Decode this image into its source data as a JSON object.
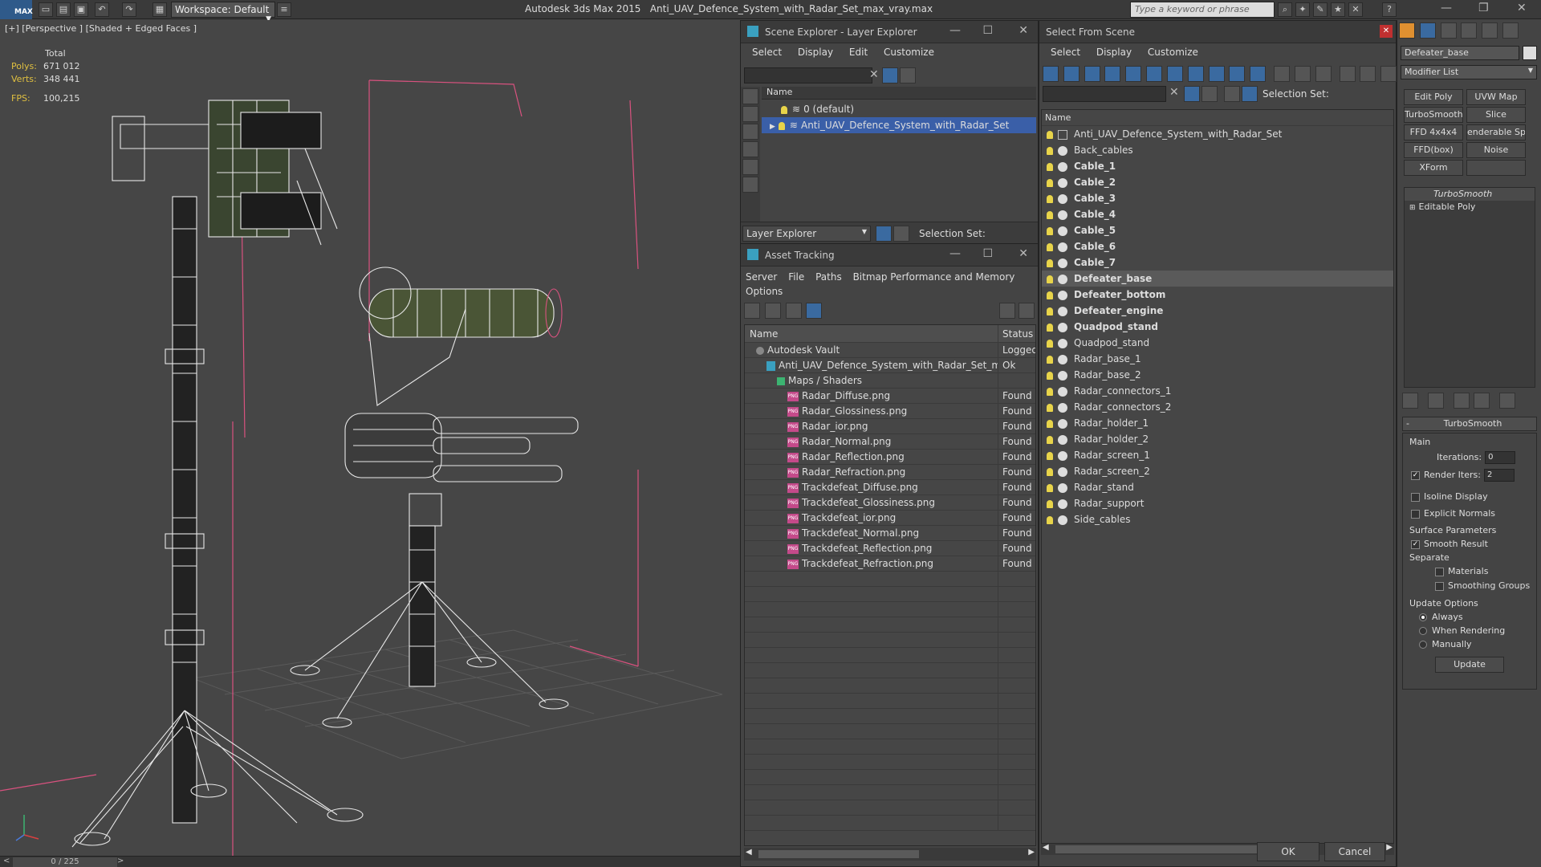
{
  "titlebar": {
    "logo": "MAX",
    "workspace": "Workspace: Default",
    "app_name": "Autodesk 3ds Max  2015",
    "file_name": "Anti_UAV_Defence_System_with_Radar_Set_max_vray.max",
    "search_placeholder": "Type a keyword or phrase"
  },
  "viewport": {
    "label": "[+] [Perspective ] [Shaded + Edged Faces ]",
    "stats_total": "Total",
    "polys_label": "Polys:",
    "polys_value": "671 012",
    "verts_label": "Verts:",
    "verts_value": "348 441",
    "fps_label": "FPS:",
    "fps_value": "100,215"
  },
  "timeline": {
    "frame": "0 / 225",
    "left": "<",
    "right": ">"
  },
  "scene_explorer": {
    "title": "Scene Explorer - Layer Explorer",
    "menu": [
      "Select",
      "Display",
      "Edit",
      "Customize"
    ],
    "col_name": "Name",
    "layers": [
      "0 (default)",
      "Anti_UAV_Defence_System_with_Radar_Set"
    ],
    "footer_label": "Layer Explorer",
    "selection_set": "Selection Set:"
  },
  "asset_tracking": {
    "title": "Asset Tracking",
    "menu": [
      "Server",
      "File",
      "Paths",
      "Bitmap Performance and Memory"
    ],
    "menu2": "Options",
    "col_name": "Name",
    "col_status": "Status",
    "rows": [
      {
        "name": "Autodesk Vault",
        "status": "Logged",
        "indent": 0
      },
      {
        "name": "Anti_UAV_Defence_System_with_Radar_Set_ma...",
        "status": "Ok",
        "indent": 1
      },
      {
        "name": "Maps / Shaders",
        "status": "",
        "indent": 2
      },
      {
        "name": "Radar_Diffuse.png",
        "status": "Found",
        "indent": 3
      },
      {
        "name": "Radar_Glossiness.png",
        "status": "Found",
        "indent": 3
      },
      {
        "name": "Radar_ior.png",
        "status": "Found",
        "indent": 3
      },
      {
        "name": "Radar_Normal.png",
        "status": "Found",
        "indent": 3
      },
      {
        "name": "Radar_Reflection.png",
        "status": "Found",
        "indent": 3
      },
      {
        "name": "Radar_Refraction.png",
        "status": "Found",
        "indent": 3
      },
      {
        "name": "Trackdefeat_Diffuse.png",
        "status": "Found",
        "indent": 3
      },
      {
        "name": "Trackdefeat_Glossiness.png",
        "status": "Found",
        "indent": 3
      },
      {
        "name": "Trackdefeat_ior.png",
        "status": "Found",
        "indent": 3
      },
      {
        "name": "Trackdefeat_Normal.png",
        "status": "Found",
        "indent": 3
      },
      {
        "name": "Trackdefeat_Reflection.png",
        "status": "Found",
        "indent": 3
      },
      {
        "name": "Trackdefeat_Refraction.png",
        "status": "Found",
        "indent": 3
      }
    ]
  },
  "select_from_scene": {
    "title": "Select From Scene",
    "menu": [
      "Select",
      "Display",
      "Customize"
    ],
    "selection_set": "Selection Set:",
    "col_name": "Name",
    "objects": [
      {
        "name": "Anti_UAV_Defence_System_with_Radar_Set",
        "bold": false
      },
      {
        "name": "Back_cables",
        "bold": false
      },
      {
        "name": "Cable_1",
        "bold": true
      },
      {
        "name": "Cable_2",
        "bold": true
      },
      {
        "name": "Cable_3",
        "bold": true
      },
      {
        "name": "Cable_4",
        "bold": true
      },
      {
        "name": "Cable_5",
        "bold": true
      },
      {
        "name": "Cable_6",
        "bold": true
      },
      {
        "name": "Cable_7",
        "bold": true
      },
      {
        "name": "Defeater_base",
        "bold": true
      },
      {
        "name": "Defeater_bottom",
        "bold": true
      },
      {
        "name": "Defeater_engine",
        "bold": true
      },
      {
        "name": "Quadpod_stand",
        "bold": true
      },
      {
        "name": "Quadpod_stand",
        "bold": false
      },
      {
        "name": "Radar_base_1",
        "bold": false
      },
      {
        "name": "Radar_base_2",
        "bold": false
      },
      {
        "name": "Radar_connectors_1",
        "bold": false
      },
      {
        "name": "Radar_connectors_2",
        "bold": false
      },
      {
        "name": "Radar_holder_1",
        "bold": false
      },
      {
        "name": "Radar_holder_2",
        "bold": false
      },
      {
        "name": "Radar_screen_1",
        "bold": false
      },
      {
        "name": "Radar_screen_2",
        "bold": false
      },
      {
        "name": "Radar_stand",
        "bold": false
      },
      {
        "name": "Radar_support",
        "bold": false
      },
      {
        "name": "Side_cables",
        "bold": false
      }
    ],
    "ok": "OK",
    "cancel": "Cancel"
  },
  "command_panel": {
    "object_name": "Defeater_base",
    "modifier_list": "Modifier List",
    "buttons": [
      "Edit Poly",
      "UVW Map",
      "TurboSmooth",
      "Slice",
      "FFD 4x4x4",
      "enderable Spli",
      "FFD(box)",
      "Noise",
      "XForm",
      ""
    ],
    "stack": [
      "TurboSmooth",
      "Editable Poly"
    ],
    "rollout_title": "TurboSmooth",
    "main_label": "Main",
    "iterations_label": "Iterations:",
    "iterations_value": "0",
    "render_iters_label": "Render Iters:",
    "render_iters_value": "2",
    "isoline": "Isoline Display",
    "explicit_normals": "Explicit Normals",
    "surface_params": "Surface Parameters",
    "smooth_result": "Smooth Result",
    "separate": "Separate",
    "materials": "Materials",
    "smoothing_groups": "Smoothing Groups",
    "update_options": "Update Options",
    "always": "Always",
    "when_rendering": "When Rendering",
    "manually": "Manually",
    "update": "Update"
  },
  "colors": {
    "selected_row": "#3a5fa8",
    "highlight_row": "#5a5a5a",
    "accent_pink": "#d9527f"
  }
}
